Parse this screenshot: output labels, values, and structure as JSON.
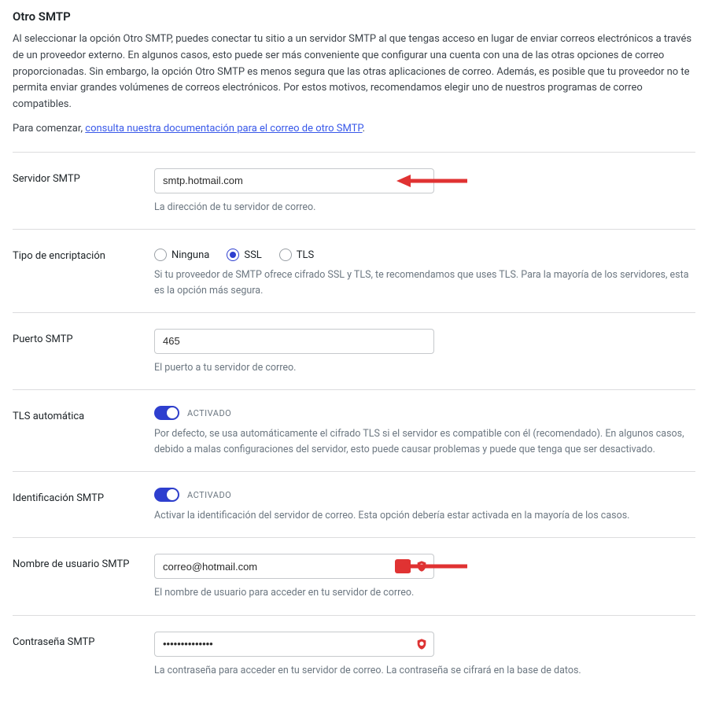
{
  "header": {
    "title": "Otro SMTP",
    "intro": "Al seleccionar la opción Otro SMTP, puedes conectar tu sitio a un servidor SMTP al que tengas acceso en lugar de enviar correos electrónicos a través de un proveedor externo. En algunos casos, esto puede ser más conveniente que configurar una cuenta con una de las otras opciones de correo proporcionadas. Sin embargo, la opción Otro SMTP es menos segura que las otras aplicaciones de correo. Además, es posible que tu proveedor no te permita enviar grandes volúmenes de correos electrónicos. Por estos motivos, recomendamos elegir uno de nuestros programas de correo compatibles.",
    "pre_link": "Para comenzar, ",
    "link_text": "consulta nuestra documentación para el correo de otro SMTP",
    "post_link": "."
  },
  "smtp_host": {
    "label": "Servidor SMTP",
    "value": "smtp.hotmail.com",
    "help": "La dirección de tu servidor de correo."
  },
  "encryption": {
    "label": "Tipo de encriptación",
    "options": {
      "none": "Ninguna",
      "ssl": "SSL",
      "tls": "TLS"
    },
    "help": "Si tu proveedor de SMTP ofrece cifrado SSL y TLS, te recomendamos que uses TLS. Para la mayoría de los servidores, esta es la opción más segura."
  },
  "smtp_port": {
    "label": "Puerto SMTP",
    "value": "465",
    "help": "El puerto a tu servidor de correo."
  },
  "auto_tls": {
    "label": "TLS automática",
    "state": "ACTIVADO",
    "help": "Por defecto, se usa automáticamente el cifrado TLS si el servidor es compatible con él (recomendado). En algunos casos, debido a malas configuraciones del servidor, esto puede causar problemas y puede que tenga que ser desactivado."
  },
  "smtp_auth": {
    "label": "Identificación SMTP",
    "state": "ACTIVADO",
    "help": "Activar la identificación del servidor de correo. Esta opción debería estar activada en la mayoría de los casos."
  },
  "smtp_user": {
    "label": "Nombre de usuario SMTP",
    "value": "correo@hotmail.com",
    "help": "El nombre de usuario para acceder en tu servidor de correo."
  },
  "smtp_pass": {
    "label": "Contraseña SMTP",
    "value": "••••••••••••••",
    "help": "La contraseña para acceder en tu servidor de correo. La contraseña se cifrará en la base de datos."
  }
}
